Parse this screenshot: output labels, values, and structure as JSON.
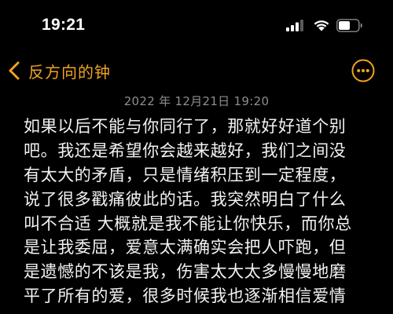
{
  "status_bar": {
    "time": "19:21",
    "icons": [
      "signal-icon",
      "wifi-icon",
      "battery-icon"
    ]
  },
  "nav": {
    "back_icon": "chevron-left-icon",
    "back_label": "反方向的钟",
    "more_icon": "ellipsis-circle-icon",
    "accent_color": "#f0a323"
  },
  "note": {
    "date": "2022 年 12月21日 19:20",
    "lines": [
      "如果以后不能与你同行了，那就好好道个别",
      "吧。我还是希望你会越来越好，我们之间没",
      "有太大的矛盾，只是情绪积压到一定程度，",
      "说了很多戳痛彼此的话。我突然明白了什么",
      "叫不合适 大概就是我不能让你快乐，而你总",
      "是让我委屈，爱意太满确实会把人吓跑，但",
      "是遗憾的不该是我，伤害太大太多慢慢地磨",
      "平了所有的爱，很多时候我也逐渐相信爱情"
    ]
  }
}
